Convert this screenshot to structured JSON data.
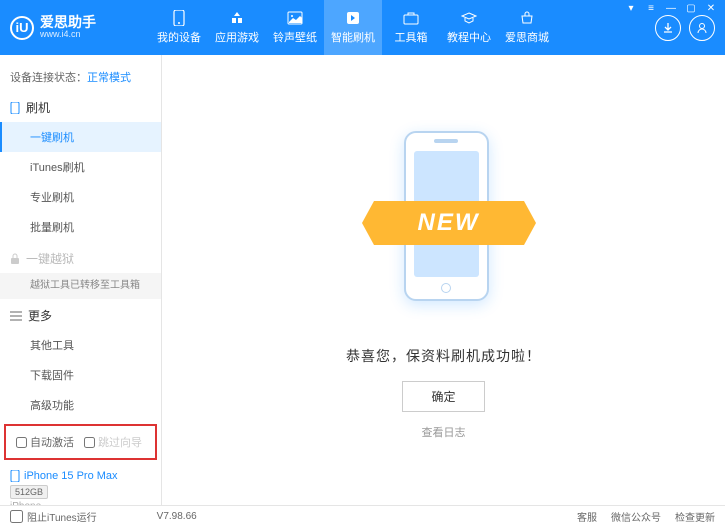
{
  "header": {
    "logo_text": "爱思助手",
    "logo_url": "www.i4.cn",
    "logo_letter": "iU"
  },
  "nav": [
    {
      "label": "我的设备"
    },
    {
      "label": "应用游戏"
    },
    {
      "label": "铃声壁纸"
    },
    {
      "label": "智能刷机"
    },
    {
      "label": "工具箱"
    },
    {
      "label": "教程中心"
    },
    {
      "label": "爱思商城"
    }
  ],
  "sidebar": {
    "status_label": "设备连接状态：",
    "status_value": "正常模式",
    "flash_label": "刷机",
    "flash_items": [
      "一键刷机",
      "iTunes刷机",
      "专业刷机",
      "批量刷机"
    ],
    "jailbreak_label": "一键越狱",
    "jailbreak_tip": "越狱工具已转移至工具箱",
    "more_label": "更多",
    "more_items": [
      "其他工具",
      "下载固件",
      "高级功能"
    ],
    "cb_auto": "自动激活",
    "cb_skip": "跳过向导",
    "device_name": "iPhone 15 Pro Max",
    "storage": "512GB",
    "device_type": "iPhone"
  },
  "main": {
    "ribbon": "NEW",
    "success": "恭喜您，保资料刷机成功啦！",
    "confirm": "确定",
    "view_log": "查看日志"
  },
  "footer": {
    "block_itunes": "阻止iTunes运行",
    "version": "V7.98.66",
    "links": [
      "客服",
      "微信公众号",
      "检查更新"
    ]
  }
}
